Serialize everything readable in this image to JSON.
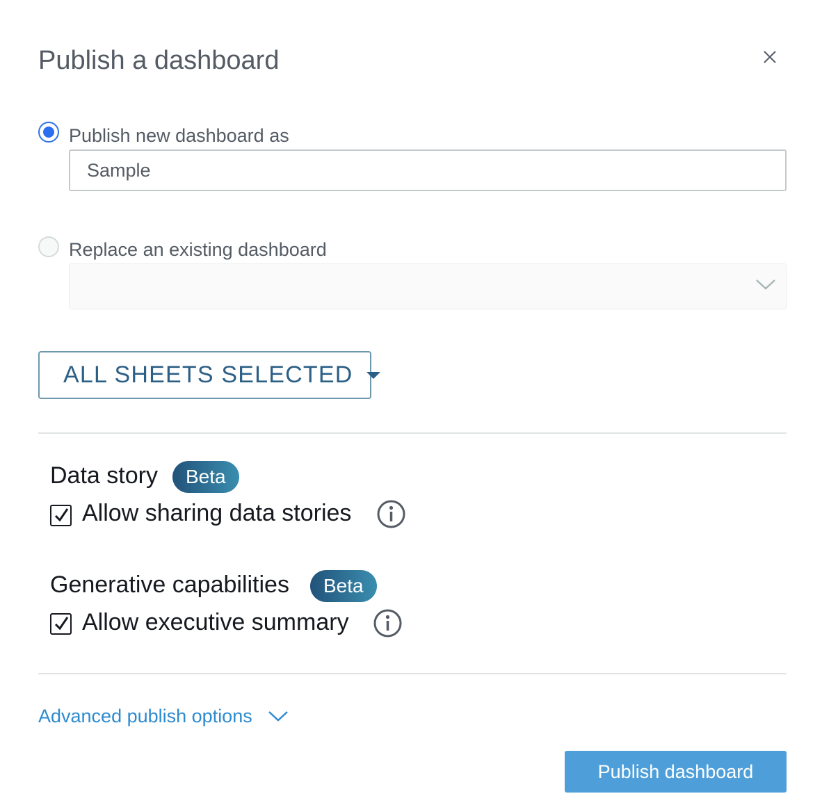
{
  "dialog": {
    "title": "Publish a dashboard",
    "close_icon": "close-icon"
  },
  "publish_new": {
    "label": "Publish new dashboard as",
    "selected": true,
    "value": "Sample"
  },
  "replace_existing": {
    "label": "Replace an existing dashboard",
    "selected": false,
    "dropdown_value": ""
  },
  "sheets": {
    "label": "ALL SHEETS SELECTED"
  },
  "data_story": {
    "title": "Data story",
    "badge": "Beta",
    "option_label": "Allow sharing data stories",
    "checked": true
  },
  "generative": {
    "title": "Generative capabilities",
    "badge": "Beta",
    "option_label": "Allow executive summary",
    "checked": true
  },
  "advanced": {
    "label": "Advanced publish options"
  },
  "actions": {
    "publish_label": "Publish dashboard"
  },
  "colors": {
    "primary": "#4e9fd9",
    "radio_selected": "#2a6ff0",
    "link": "#2d8bd0",
    "sheets_text": "#2c5f86"
  }
}
